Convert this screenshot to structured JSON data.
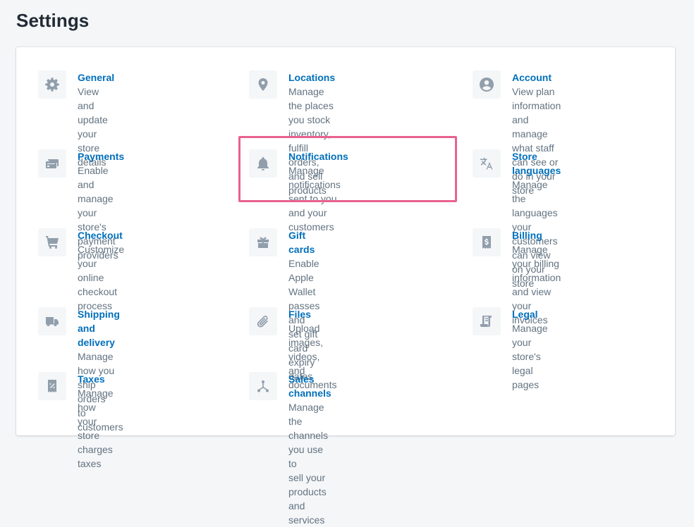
{
  "page": {
    "title": "Settings"
  },
  "settings": {
    "general": {
      "title": "General",
      "desc1": "View and update your store",
      "desc2": "details",
      "icon": "gear-icon"
    },
    "locations": {
      "title": "Locations",
      "desc1": "Manage the places you stock",
      "desc2": "inventory, fulfill orders, and sell",
      "desc3": "products",
      "icon": "location-pin-icon"
    },
    "account": {
      "title": "Account",
      "desc1": "View plan information and",
      "desc2": "manage what staff can see or",
      "desc3": "do in your store",
      "icon": "user-circle-icon"
    },
    "payments": {
      "title": "Payments",
      "desc1": "Enable and manage your",
      "desc2": "store's payment providers",
      "icon": "credit-card-icon"
    },
    "notifications": {
      "title": "Notifications",
      "desc1": "Manage notifications sent to you",
      "desc2": "and your customers",
      "icon": "bell-icon"
    },
    "store_languages": {
      "title": "Store languages",
      "desc1": "Manage the languages your",
      "desc2": "customers can view on your",
      "desc3": "store",
      "icon": "translate-icon"
    },
    "checkout": {
      "title": "Checkout",
      "desc1": "Customize your online",
      "desc2": "checkout process",
      "icon": "cart-icon"
    },
    "gift_cards": {
      "title": "Gift cards",
      "desc1": "Enable Apple Wallet passes and",
      "desc2": "set gift card expiry dates",
      "icon": "gift-icon"
    },
    "billing": {
      "title": "Billing",
      "desc1": "Manage your billing",
      "desc2": "information and view your",
      "desc3": "invoices",
      "icon": "receipt-dollar-icon"
    },
    "shipping": {
      "title": "Shipping and delivery",
      "desc1": "Manage how you ship orders",
      "desc2": "to customers",
      "icon": "truck-icon"
    },
    "files": {
      "title": "Files",
      "desc1": "Upload images, videos, and",
      "desc2": "documents",
      "icon": "paperclip-icon"
    },
    "legal": {
      "title": "Legal",
      "desc1": "Manage your store's legal",
      "desc2": "pages",
      "icon": "document-icon"
    },
    "taxes": {
      "title": "Taxes",
      "desc1": "Manage how your store",
      "desc2": "charges taxes",
      "icon": "tax-receipt-icon"
    },
    "sales_channels": {
      "title": "Sales channels",
      "desc1": "Manage the channels you use to",
      "desc2": "sell your products and services",
      "icon": "channels-icon"
    }
  },
  "colors": {
    "link": "#006fbb",
    "text_subdued": "#637381",
    "icon": "#919eab",
    "highlight": "#e8628e",
    "background": "#f4f6f8"
  }
}
